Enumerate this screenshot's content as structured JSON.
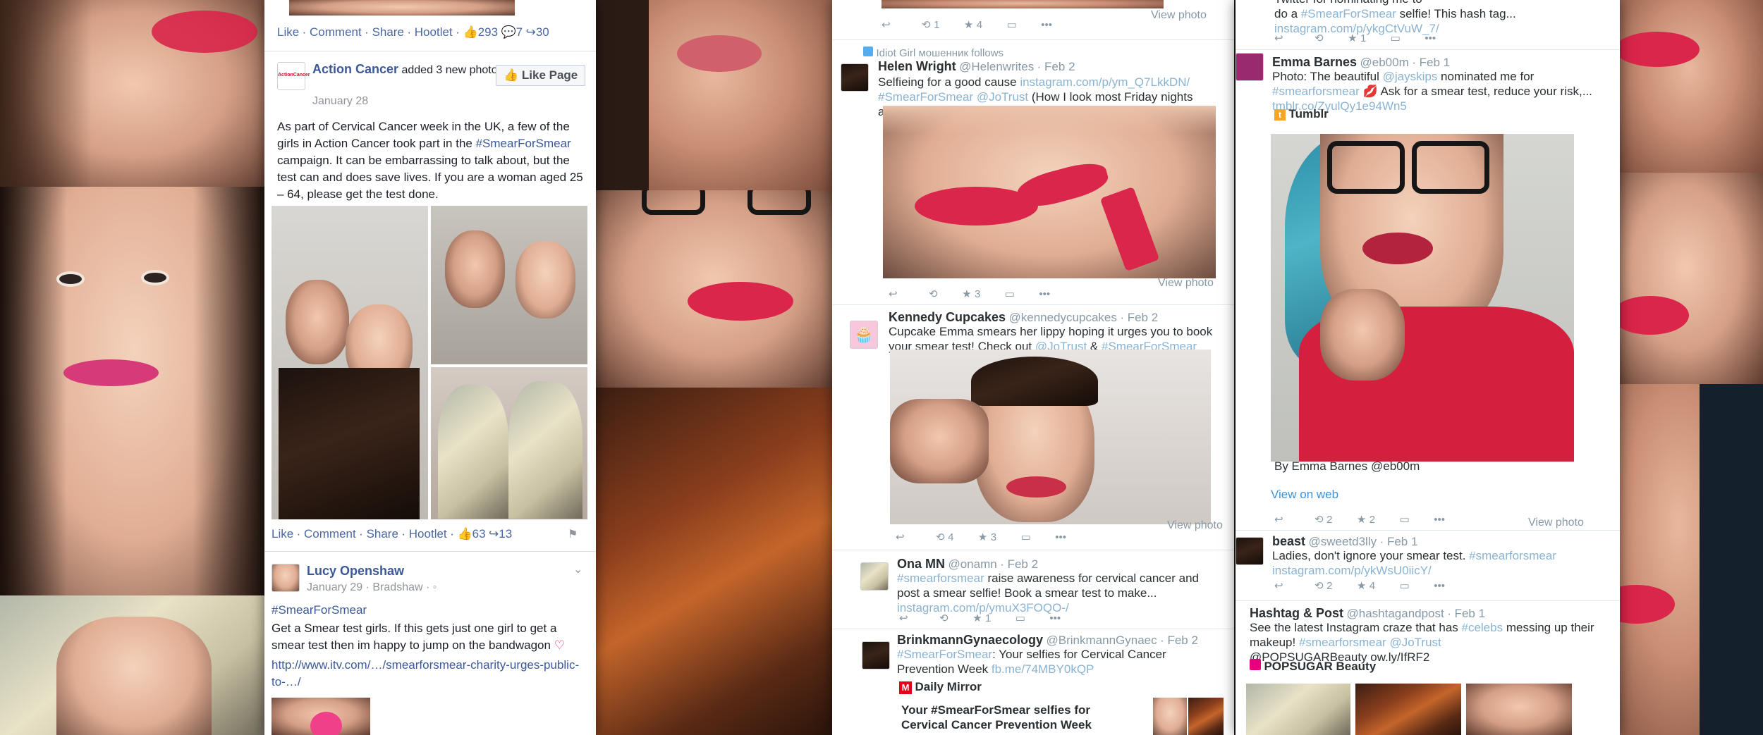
{
  "facebook": {
    "top_actions": {
      "like": "Like",
      "comment": "Comment",
      "share": "Share",
      "hootlet": "Hootlet",
      "likes": "293",
      "comments": "7",
      "shares": "30"
    },
    "post1": {
      "author": "Action Cancer",
      "action": "added 3 new photos.",
      "date": "January 28",
      "like_page": "Like Page",
      "avatar_text": "ActionCancer",
      "text_pre": "As part of Cervical Cancer week in the UK, a few of the girls in Action Cancer took part in the ",
      "hashtag": "#SmearForSmear",
      "text_post": " campaign. It can be embarrassing to talk about, but the test can and does save lives. If you are a woman aged 25 – 64, please get the test done.",
      "actions": {
        "like": "Like",
        "comment": "Comment",
        "share": "Share",
        "hootlet": "Hootlet",
        "likes": "63",
        "shares": "13"
      }
    },
    "post2": {
      "author": "Lucy Openshaw",
      "date": "January 29",
      "location": "Bradshaw",
      "hashtag": "#SmearForSmear",
      "text": "Get a Smear test girls. If this gets just one girl to get a smear test then im happy to jump on the bandwagon",
      "link": "http://www.itv.com/…/smearforsmear-charity-urges-public-to-…/"
    }
  },
  "twitter_mid": {
    "top": {
      "retweets": "1",
      "favorites": "4",
      "view_photo": "View photo"
    },
    "follows_note": "Idiot Girl мошенник follows",
    "tweet1": {
      "name": "Helen Wright",
      "handle": "@Helenwrites",
      "date": "Feb 2",
      "text1": "Selfieing for a good cause ",
      "link1": "instagram.com/p/ym_Q7LkkDN/",
      "link2": "#SmearForSmear @JoTrust",
      "text2": " (How I look most Friday nights anyway...)",
      "favorites": "3",
      "view_photo": "View photo"
    },
    "tweet2": {
      "name": "Kennedy Cupcakes",
      "handle": "@kennedycupcakes",
      "date": "Feb 2",
      "text1": "Cupcake Emma smears her lippy hoping it urges you to book your smear test! Check out ",
      "link1": "@JoTrust",
      "text2": " & ",
      "link2": "#SmearForSmear",
      "retweets": "4",
      "favorites": "3",
      "view_photo": "View photo"
    },
    "tweet3": {
      "name": "Ona MN",
      "handle": "@onamn",
      "date": "Feb 2",
      "link1": "#smearforsmear",
      "text1": " raise awareness for cervical cancer and post a smear selfie! Book a smear test to make...",
      "link2": "instagram.com/p/ymuX3FOQO-/",
      "favorites": "1"
    },
    "tweet4": {
      "name": "BrinkmannGynaecology",
      "handle": "@BrinkmannGynaec",
      "date": "Feb 2",
      "link1": "#SmearForSmear",
      "text1": ": Your selfies for Cervical Cancer Prevention Week ",
      "link2": "fb.me/74MBY0kQP",
      "source": "Daily Mirror",
      "headline": "Your #SmearForSmear selfies for Cervical Cancer Prevention Week"
    }
  },
  "twitter_right": {
    "top": {
      "text1": "do a ",
      "link1": "#SmearForSmear",
      "text2": " selfie! This hash tag...",
      "link2": "instagram.com/p/ykgCtVuW_7/",
      "favorites": "1",
      "top_fragment": "Twitter for nominating me to"
    },
    "tweet1": {
      "name": "Emma Barnes",
      "handle": "@eb00m",
      "date": "Feb 1",
      "text1": "Photo: The beautiful ",
      "link1": "@jayskips",
      "text2": " nominated me for ",
      "link2": "#smearforsmear",
      "text3": " Ask for a smear test, reduce your risk,...",
      "link3": "tmblr.co/ZyulQy1e94Wn5",
      "source": "Tumblr",
      "by": "By Emma Barnes @eb00m",
      "view_web": "View on web",
      "retweets": "2",
      "favorites": "2",
      "view_photo": "View photo"
    },
    "tweet2": {
      "name": "beast",
      "handle": "@sweetd3lly",
      "date": "Feb 1",
      "text1": "Ladies, don't ignore your smear test. ",
      "link1": "#smearforsmear",
      "link2": "instagram.com/p/ykWsU0iicY/",
      "retweets": "2",
      "favorites": "4"
    },
    "tweet3": {
      "name": "Hashtag & Post",
      "handle": "@hashtagandpost",
      "date": "Feb 1",
      "text1": "See the latest Instagram craze that has ",
      "link1": "#celebs",
      "text2": " messing up their makeup! ",
      "link2": "#smearforsmear",
      "link3": "@JoTrust",
      "text3": "@POPSUGARBeauty ow.ly/IfRF2",
      "source": "POPSUGAR Beauty"
    }
  },
  "colors": {
    "facebook_blue": "#3b5998",
    "twitter_link": "#8ab3d1",
    "lipstick": "#d9264a"
  }
}
